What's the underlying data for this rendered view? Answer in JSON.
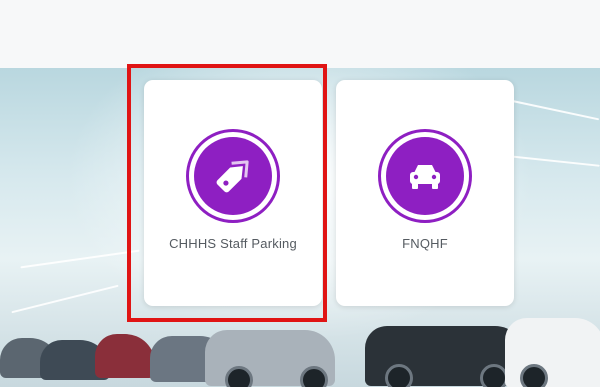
{
  "tiles": [
    {
      "label": "CHHHS Staff Parking",
      "icon": "tag-icon"
    },
    {
      "label": "FNQHF",
      "icon": "car-icon"
    }
  ],
  "colors": {
    "accent": "#8e1fc2",
    "highlight": "#e01414",
    "label_text": "#555b61"
  }
}
